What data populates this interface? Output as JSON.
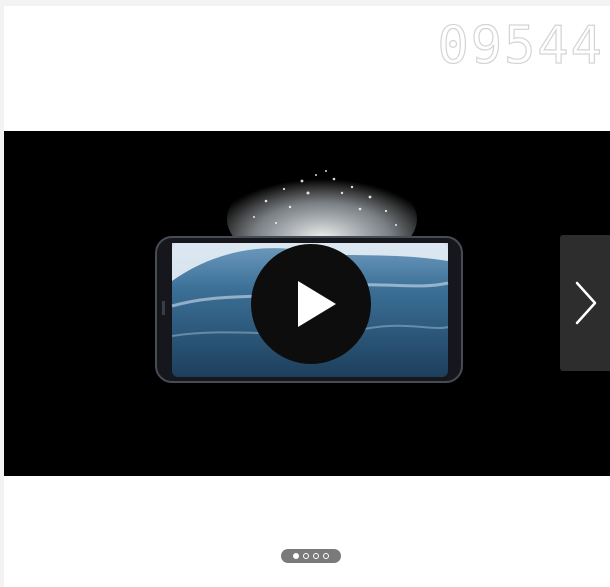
{
  "header": {
    "counter_text": "09544"
  },
  "carousel": {
    "slide_count": 4,
    "active_index": 0,
    "play_icon": "play-icon",
    "next_icon": "chevron-right-icon"
  },
  "colors": {
    "stage_bg": "#000000",
    "play_button_bg": "#111111",
    "next_button_bg": "#2d2d2d",
    "dots_bg": "#7a7a7a"
  }
}
